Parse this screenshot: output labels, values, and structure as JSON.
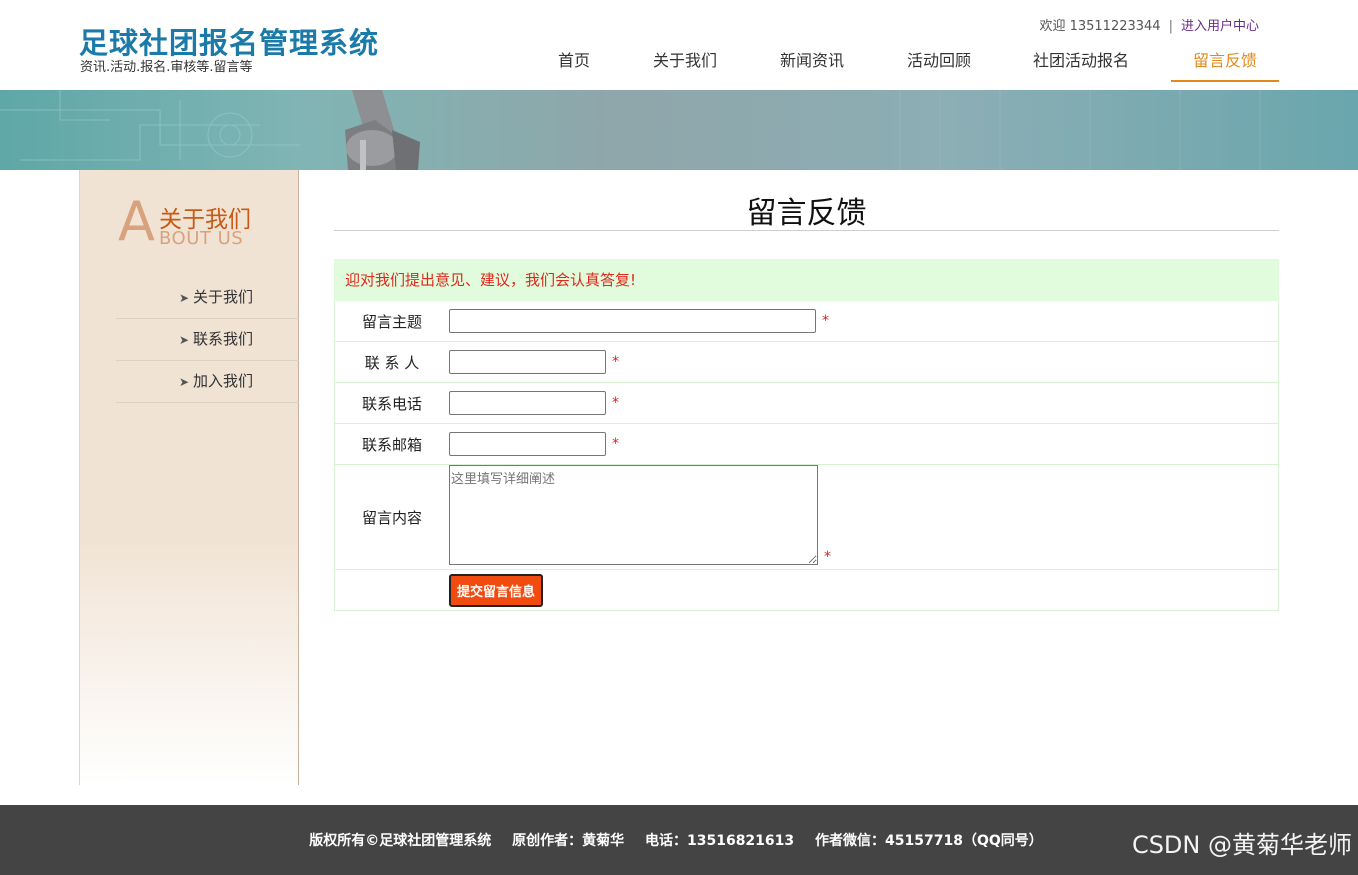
{
  "header": {
    "title": "足球社团报名管理系统",
    "subtitle": "资讯.活动.报名.审核等.留言等",
    "welcome": "欢迎 13511223344",
    "separator": "|",
    "user_center_link": "进入用户中心",
    "nav": [
      {
        "label": "首页"
      },
      {
        "label": "关于我们"
      },
      {
        "label": "新闻资讯"
      },
      {
        "label": "活动回顾"
      },
      {
        "label": "社团活动报名"
      },
      {
        "label": "留言反馈",
        "active": true
      }
    ]
  },
  "sidebar": {
    "heading_letter": "A",
    "heading_cn": "关于我们",
    "heading_en": "BOUT US",
    "chevron_icon": "chevron-right-icon",
    "items": [
      {
        "label": "关于我们"
      },
      {
        "label": "联系我们"
      },
      {
        "label": "加入我们"
      }
    ]
  },
  "main": {
    "title": "留言反馈",
    "notice": "迎对我们提出意见、建议，我们会认真答复!",
    "form": {
      "subject_label": "留言主题",
      "contact_label": "联 系 人",
      "phone_label": "联系电话",
      "email_label": "联系邮箱",
      "content_label": "留言内容",
      "content_placeholder": "这里填写详细阐述",
      "required_mark": "*",
      "submit_label": "提交留言信息"
    }
  },
  "footer": {
    "copyright": "版权所有©足球社团管理系统",
    "author": "原创作者：黄菊华",
    "phone": "电话：13516821613",
    "wechat": "作者微信：45157718（QQ同号）"
  },
  "watermark": "CSDN @黄菊华老师",
  "colors": {
    "brand_blue": "#1c7aa8",
    "active_orange": "#e08a1e",
    "notice_bg": "#e0fcdc",
    "notice_text": "#e0281c",
    "submit_bg": "#f24b10",
    "footer_bg": "#444444"
  }
}
